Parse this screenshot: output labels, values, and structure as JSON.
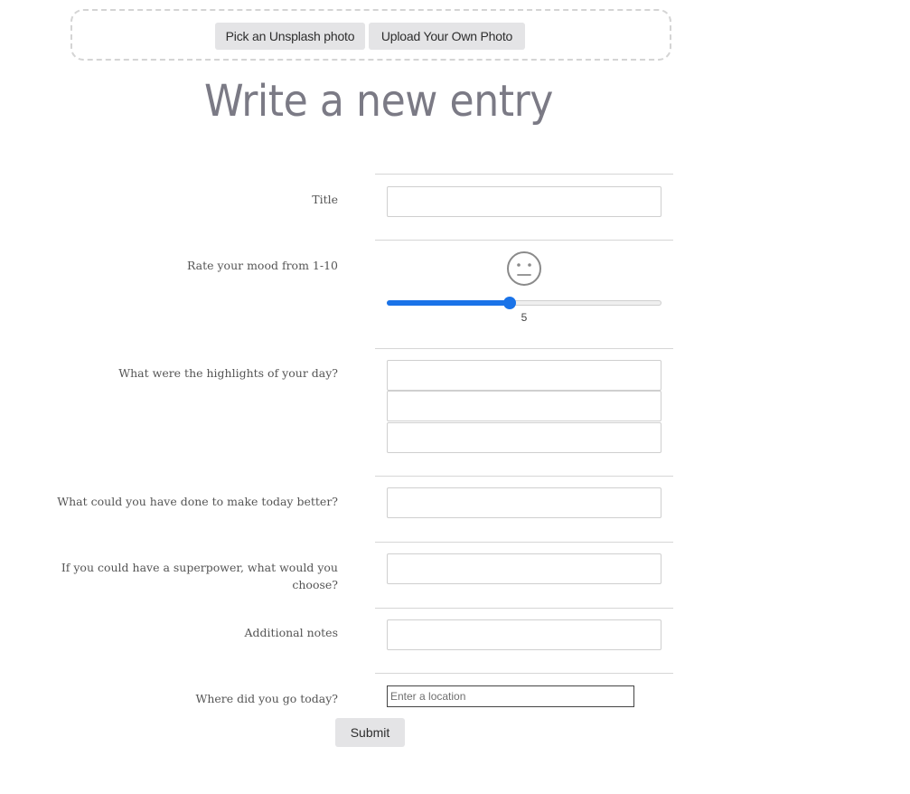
{
  "photo_picker": {
    "unsplash_label": "Pick an Unsplash photo",
    "upload_label": "Upload Your Own Photo"
  },
  "page": {
    "title": "Write a new entry"
  },
  "form": {
    "title_label": "Title",
    "title_value": "",
    "mood_label": "Rate your mood from 1-10",
    "mood": {
      "min": 1,
      "max": 10,
      "value": 5,
      "value_text": "5",
      "face_icon": "neutral-face-icon"
    },
    "highlights_label": "What were the highlights of your day?",
    "highlights": [
      "",
      "",
      ""
    ],
    "better_label": "What could you have done to make today better?",
    "better_value": "",
    "superpower_label_line1": "If you could have a superpower, what would you",
    "superpower_label_line2": "choose?",
    "superpower_value": "",
    "notes_label": "Additional notes",
    "notes_value": "",
    "location_label": "Where did you go today?",
    "location_placeholder": "Enter a location",
    "location_value": "",
    "submit_label": "Submit"
  },
  "colors": {
    "accent": "#1a73e8",
    "title_text": "#7b7a85",
    "button_bg": "#e4e4e6",
    "divider": "#d6d6d6"
  }
}
